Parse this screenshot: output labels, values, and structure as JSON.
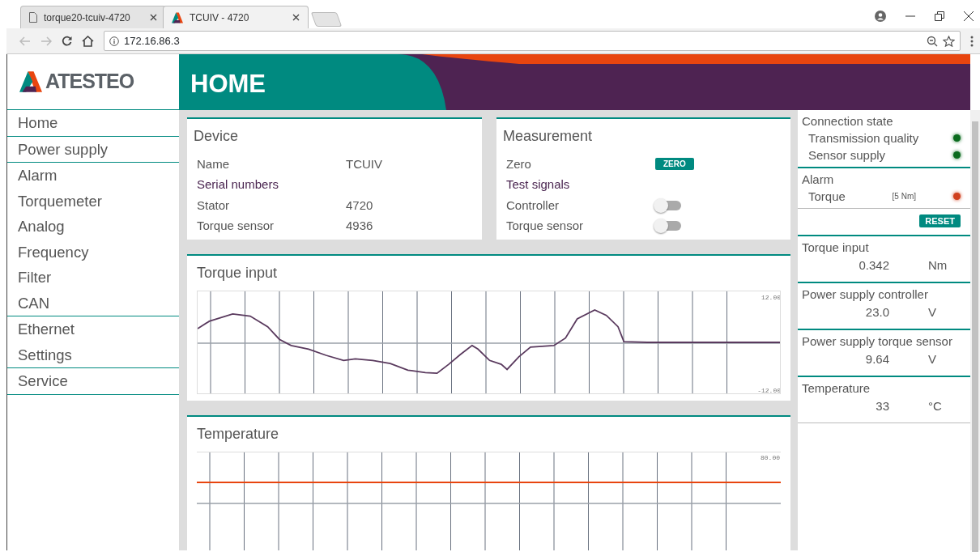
{
  "browser": {
    "tabs": [
      {
        "title": "torque20-tcuiv-4720",
        "selected": false,
        "kind": "page"
      },
      {
        "title": "TCUIV - 4720",
        "selected": true,
        "kind": "logo"
      }
    ],
    "address": "172.16.86.3"
  },
  "logo": {
    "text": "ATESTEO"
  },
  "header": {
    "title": "HOME"
  },
  "nav_groups": [
    [
      "Home"
    ],
    [
      "Power supply"
    ],
    [
      "Alarm",
      "Torquemeter",
      "Analog",
      "Frequency",
      "Filter",
      "CAN"
    ],
    [
      "Ethernet",
      "Settings"
    ],
    [
      "Service"
    ]
  ],
  "device": {
    "title": "Device",
    "rows": [
      {
        "kind": "pair",
        "label": "Name",
        "value": "TCUIV"
      },
      {
        "kind": "heading",
        "label": "Serial numbers"
      },
      {
        "kind": "pair",
        "label": "Stator",
        "value": "4720"
      },
      {
        "kind": "pair",
        "label": "Torque sensor",
        "value": "4936"
      }
    ]
  },
  "measurement": {
    "title": "Measurement",
    "rows": [
      {
        "kind": "button",
        "label": "Zero",
        "button": "ZERO"
      },
      {
        "kind": "heading",
        "label": "Test signals"
      },
      {
        "kind": "toggle",
        "label": "Controller",
        "on": false
      },
      {
        "kind": "toggle",
        "label": "Torque sensor",
        "on": false
      }
    ]
  },
  "torque_chart": {
    "title": "Torque input",
    "top_label": "12.00",
    "bottom_label": "-12.00"
  },
  "temperature_chart": {
    "title": "Temperature",
    "top_label": "80.00"
  },
  "side": {
    "connection": {
      "title": "Connection state",
      "items": [
        {
          "label": "Transmission quality",
          "color": "#0b6b1e"
        },
        {
          "label": "Sensor supply",
          "color": "#0b6b1e"
        }
      ]
    },
    "alarm": {
      "title": "Alarm",
      "items": [
        {
          "label": "Torque",
          "limit": "[5 Nm]",
          "color": "#d0401e"
        }
      ],
      "button": "RESET"
    },
    "readings": [
      {
        "title": "Torque input",
        "value": "0.342",
        "unit": "Nm"
      },
      {
        "title": "Power supply controller",
        "value": "23.0",
        "unit": "V"
      },
      {
        "title": "Power supply torque sensor",
        "value": "9.64",
        "unit": "V"
      },
      {
        "title": "Temperature",
        "value": "33",
        "unit": "°C"
      }
    ]
  }
}
